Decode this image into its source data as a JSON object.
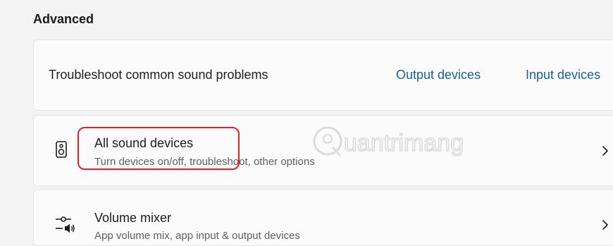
{
  "section": {
    "title": "Advanced"
  },
  "troubleshoot_card": {
    "label": "Troubleshoot common sound problems",
    "links": [
      {
        "label": "Output devices"
      },
      {
        "label": "Input devices"
      }
    ]
  },
  "rows": [
    {
      "title": "All sound devices",
      "subtitle": "Turn devices on/off, troubleshoot, other options",
      "icon": "speaker-icon"
    },
    {
      "title": "Volume mixer",
      "subtitle": "App volume mix, app input & output devices",
      "icon": "volume-mixer-icon"
    }
  ],
  "annotation": {
    "highlight_color": "#e8202a"
  },
  "watermark": {
    "text": "uantrimang"
  }
}
